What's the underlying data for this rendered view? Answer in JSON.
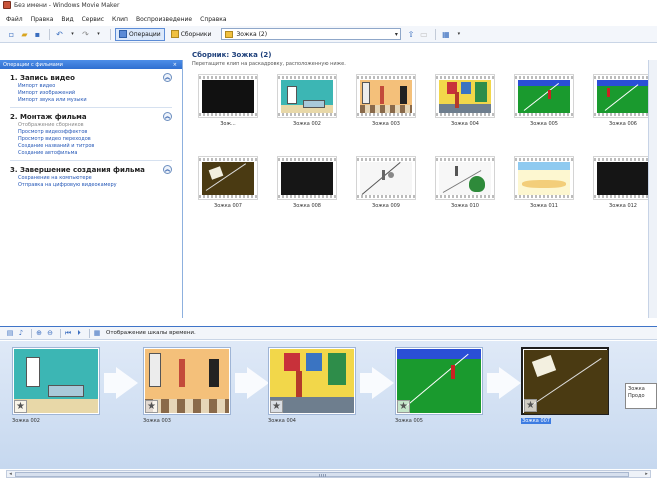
{
  "window": {
    "title": "Без имени - Windows Movie Maker"
  },
  "menu": [
    "Файл",
    "Правка",
    "Вид",
    "Сервис",
    "Клип",
    "Воспроизведение",
    "Справка"
  ],
  "toolbar": {
    "operations_label": "Операции",
    "collections_label": "Сборники",
    "collection_value": "Зожка (2)"
  },
  "taskpane": {
    "header": "Операции с фильмами",
    "sections": [
      {
        "title": "1. Запись видео",
        "links": [
          "Импорт видео",
          "Импорт изображений",
          "Импорт звука или музыки"
        ]
      },
      {
        "title": "2. Монтаж фильма",
        "links": [
          "Отображение сборников",
          "Просмотр видеоэффектов",
          "Просмотр видео переходов",
          "Создание названий и титров",
          "Создание автофильма"
        ]
      },
      {
        "title": "3. Завершение создания фильма",
        "links": [
          "Сохранение на компьютере",
          "Отправка на цифровую видеокамеру"
        ]
      }
    ]
  },
  "collection": {
    "title": "Сборник: Зожка (2)",
    "hint": "Перетащите клип на раскадровку, расположенную ниже.",
    "clips": [
      "Зож...",
      "Зожка 002",
      "Зожка 003",
      "Зожка 004",
      "Зожка 005",
      "Зожка 006",
      "Зожка 007",
      "Зожка 008",
      "Зожка 009",
      "Зожка 010",
      "Зожка 011",
      "Зожка 012"
    ]
  },
  "storyboard": {
    "toolbar_label": "Отображение шкалы времени.",
    "clips": [
      "Зожка 002",
      "Зожка 003",
      "Зожка 004",
      "Зожка 005",
      "Зожка 007"
    ],
    "tooltip_lines": [
      "Зожка",
      "Продо"
    ]
  },
  "colors": {
    "accent": "#2f6fd0",
    "link": "#2457b7",
    "selection": "#3d7ce2"
  }
}
